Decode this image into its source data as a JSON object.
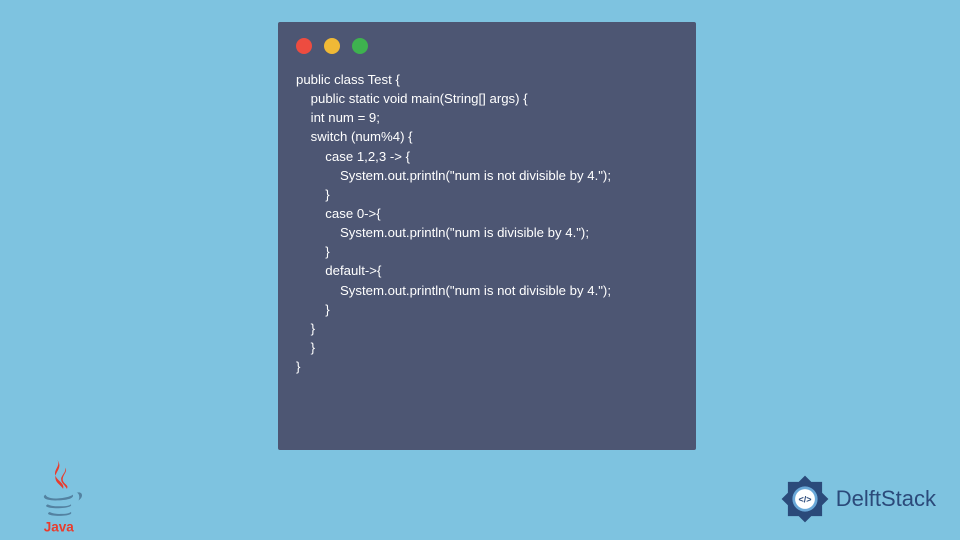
{
  "window": {
    "dots": [
      "red",
      "yellow",
      "green"
    ]
  },
  "code": {
    "lines": [
      "public class Test {",
      "    public static void main(String[] args) {",
      "    int num = 9;",
      "    switch (num%4) {",
      "        case 1,2,3 -> {",
      "            System.out.println(\"num is not divisible by 4.\");",
      "        }",
      "        case 0->{",
      "            System.out.println(\"num is divisible by 4.\");",
      "        }",
      "        default->{",
      "            System.out.println(\"num is not divisible by 4.\");",
      "        }",
      "    }",
      "    }",
      "}"
    ]
  },
  "branding": {
    "java_label": "Java",
    "delft_label": "DelftStack"
  },
  "colors": {
    "background": "#7ec3e0",
    "window": "#4d5673",
    "code_text": "#ffffff",
    "dot_red": "#ed4c40",
    "dot_yellow": "#f0b936",
    "dot_green": "#3eb24f",
    "java_red": "#e83c2e",
    "java_blue": "#5382a1",
    "delft_blue": "#2b4a7a"
  }
}
